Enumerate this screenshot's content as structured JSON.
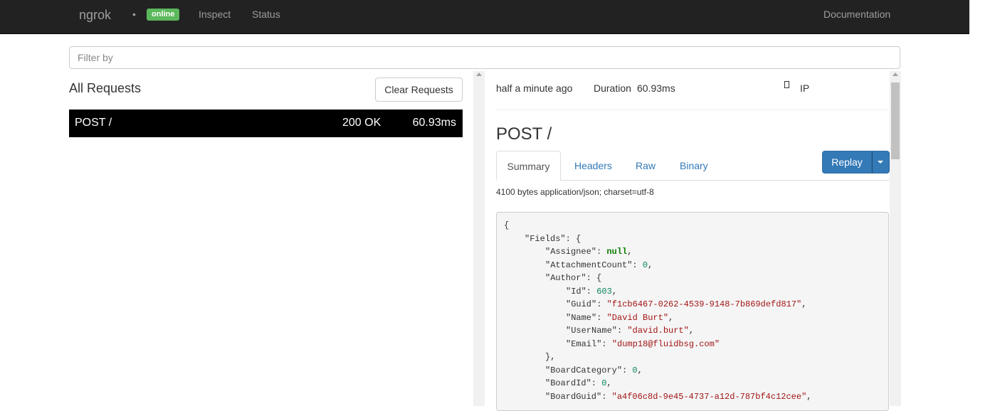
{
  "navbar": {
    "brand": "ngrok",
    "separator": "•",
    "status_badge": "online",
    "links": {
      "inspect": "Inspect",
      "status": "Status",
      "documentation": "Documentation"
    }
  },
  "filter": {
    "placeholder": "Filter by",
    "value": ""
  },
  "requests_panel": {
    "title": "All Requests",
    "clear_button": "Clear Requests",
    "rows": [
      {
        "method_path": "POST /",
        "status": "200 OK",
        "duration": "60.93ms"
      }
    ]
  },
  "detail": {
    "time_ago": "half a minute ago",
    "duration_label": "Duration",
    "duration_value": "60.93ms",
    "ip_icon": "mobile-icon",
    "ip_label": "IP",
    "title": "POST /",
    "tabs": [
      "Summary",
      "Headers",
      "Raw",
      "Binary"
    ],
    "active_tab": "Summary",
    "replay_button": "Replay",
    "body_info": "4100 bytes application/json; charset=utf-8",
    "json_lines": [
      {
        "indent": 0,
        "key": "",
        "sep": "",
        "value": "{",
        "vtype": "p",
        "tail": ""
      },
      {
        "indent": 1,
        "key": "\"Fields\"",
        "sep": ": ",
        "value": "{",
        "vtype": "p",
        "tail": ""
      },
      {
        "indent": 2,
        "key": "\"Assignee\"",
        "sep": ": ",
        "value": "null",
        "vtype": "lit",
        "tail": ","
      },
      {
        "indent": 2,
        "key": "\"AttachmentCount\"",
        "sep": ": ",
        "value": "0",
        "vtype": "n",
        "tail": ","
      },
      {
        "indent": 2,
        "key": "\"Author\"",
        "sep": ": ",
        "value": "{",
        "vtype": "p",
        "tail": ""
      },
      {
        "indent": 3,
        "key": "\"Id\"",
        "sep": ": ",
        "value": "603",
        "vtype": "n",
        "tail": ","
      },
      {
        "indent": 3,
        "key": "\"Guid\"",
        "sep": ": ",
        "value": "\"f1cb6467-0262-4539-9148-7b869defd817\"",
        "vtype": "s",
        "tail": ","
      },
      {
        "indent": 3,
        "key": "\"Name\"",
        "sep": ": ",
        "value": "\"David Burt\"",
        "vtype": "s",
        "tail": ","
      },
      {
        "indent": 3,
        "key": "\"UserName\"",
        "sep": ": ",
        "value": "\"david.burt\"",
        "vtype": "s",
        "tail": ","
      },
      {
        "indent": 3,
        "key": "\"Email\"",
        "sep": ": ",
        "value": "\"dump18@fluidbsg.com\"",
        "vtype": "s",
        "tail": ""
      },
      {
        "indent": 2,
        "key": "",
        "sep": "",
        "value": "},",
        "vtype": "p",
        "tail": ""
      },
      {
        "indent": 2,
        "key": "\"BoardCategory\"",
        "sep": ": ",
        "value": "0",
        "vtype": "n",
        "tail": ","
      },
      {
        "indent": 2,
        "key": "\"BoardId\"",
        "sep": ": ",
        "value": "0",
        "vtype": "n",
        "tail": ","
      },
      {
        "indent": 2,
        "key": "\"BoardGuid\"",
        "sep": ": ",
        "value": "\"a4f06c8d-9e45-4737-a12d-787bf4c12cee\"",
        "vtype": "s",
        "tail": ","
      }
    ]
  }
}
